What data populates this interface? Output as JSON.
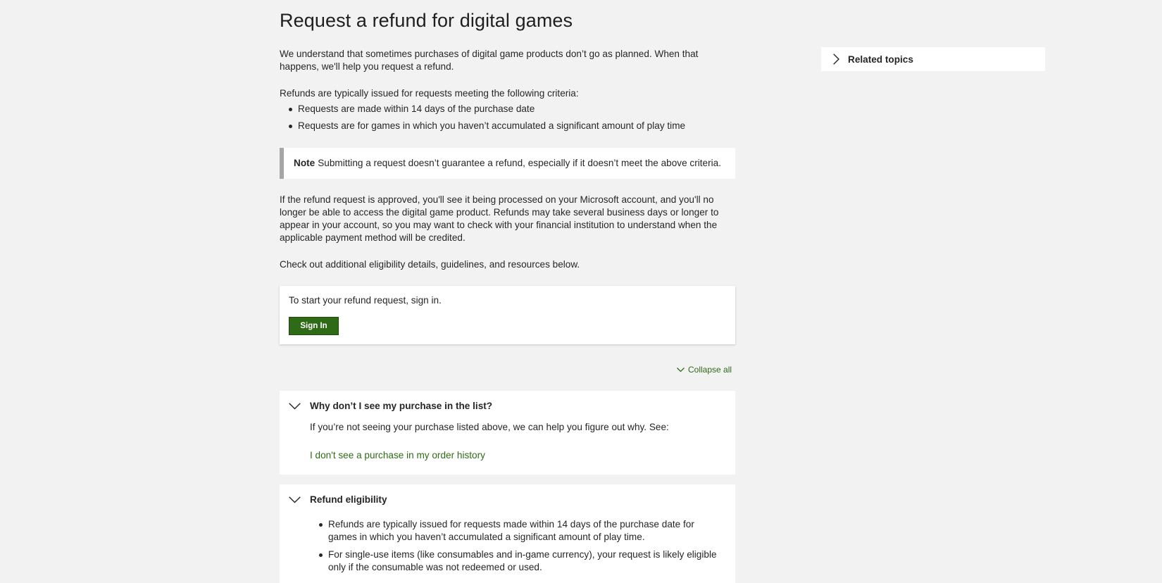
{
  "article": {
    "title": "Request a refund for digital games",
    "intro": "We understand that sometimes purchases of digital game products don’t go as planned. When that happens, we'll help you request a refund.",
    "criteria_intro": "Refunds are typically issued for requests meeting the following criteria:",
    "criteria": [
      "Requests are made within 14 days of the purchase date",
      "Requests are for games in which you haven’t accumulated a significant amount of play time"
    ],
    "note": {
      "label": "Note",
      "text": "Submitting a request doesn’t guarantee a refund, especially if it doesn’t meet the above criteria."
    },
    "approved_text": "If the refund request is approved, you'll see it being processed on your Microsoft account, and you'll no longer be able to access the digital game product. Refunds may take several business days or longer to appear in your account, so you may want to check with your financial institution to understand when the applicable payment method will be credited.",
    "check_text": "Check out additional eligibility details, guidelines, and resources below."
  },
  "signin_card": {
    "text": "To start your refund request, sign in.",
    "button_label": "Sign In"
  },
  "collapse_all_label": "Collapse all",
  "accordions": [
    {
      "title": "Why don’t I see my purchase in the list?",
      "text": "If you’re not seeing your purchase listed above, we can help you figure out why. See:",
      "link": "I don't see a purchase in my order history"
    },
    {
      "title": "Refund eligibility",
      "items": [
        "Refunds are typically issued for requests made within 14 days of the purchase date for games in which you haven’t accumulated a significant amount of play time.",
        "For single-use items (like consumables and in-game currency), your request is likely eligible only if the consumable was not redeemed or used."
      ]
    }
  ],
  "sidebar": {
    "related_topics_label": "Related topics"
  },
  "colors": {
    "background": "#f2f2f2",
    "accent_green": "#2f6a17",
    "note_border": "#a6a6a6"
  },
  "icons": {
    "accordion_expanded": "chevron-down-icon",
    "collapse_all": "chevron-down-icon",
    "related_topics": "chevron-right-icon"
  }
}
